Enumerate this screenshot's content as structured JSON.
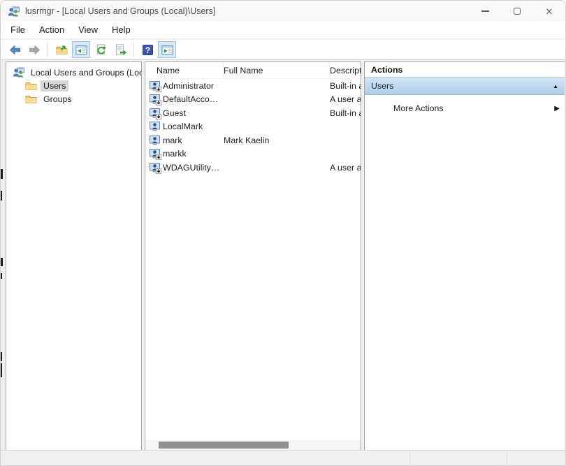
{
  "window": {
    "title": "lusrmgr - [Local Users and Groups (Local)\\Users]",
    "app_icon": "local-users-groups-icon",
    "controls": [
      "minimize-icon",
      "maximize-icon",
      "close-icon"
    ],
    "close_glyph": "✕"
  },
  "menu": {
    "items": [
      {
        "label": "File"
      },
      {
        "label": "Action"
      },
      {
        "label": "View"
      },
      {
        "label": "Help"
      }
    ]
  },
  "toolbar": {
    "buttons": [
      "back-icon",
      "forward-icon",
      "up-one-level-icon",
      "show-console-tree-icon",
      "refresh-icon",
      "export-list-icon",
      "help-icon",
      "show-action-pane-icon"
    ]
  },
  "tree": {
    "root_label": "Local Users and Groups (Local)",
    "items": [
      {
        "label": "Users",
        "selected": true
      },
      {
        "label": "Groups",
        "selected": false
      }
    ]
  },
  "list": {
    "columns": {
      "name": "Name",
      "full_name": "Full Name",
      "description": "Description"
    },
    "rows": [
      {
        "name": "Administrator",
        "full_name": "",
        "description": "Built-in a",
        "disabled": true
      },
      {
        "name": "DefaultAcco…",
        "full_name": "",
        "description": "A user ac",
        "disabled": true
      },
      {
        "name": "Guest",
        "full_name": "",
        "description": "Built-in a",
        "disabled": true
      },
      {
        "name": "LocalMark",
        "full_name": "",
        "description": "",
        "disabled": false
      },
      {
        "name": "mark",
        "full_name": "Mark Kaelin",
        "description": "",
        "disabled": false
      },
      {
        "name": "markk",
        "full_name": "",
        "description": "",
        "disabled": true
      },
      {
        "name": "WDAGUtility…",
        "full_name": "",
        "description": "A user ac",
        "disabled": true
      }
    ]
  },
  "actions": {
    "title": "Actions",
    "group_label": "Users",
    "collapse_glyph": "▲",
    "item_label": "More Actions",
    "expand_glyph": "▶"
  },
  "colors": {
    "titlebar_bg": "#f9f9f9",
    "content_bg": "#f0f0f0",
    "panel_border": "#a7a7a7",
    "toolbar_highlight_bg": "#d8e9f7",
    "toolbar_highlight_border": "#9cc3e5",
    "tree_selection": "#d6d6d6",
    "actions_group_gradient_top": "#d3e5f6",
    "actions_group_gradient_bottom": "#aecde9",
    "scrollbar_thumb": "#8f8f8f"
  }
}
